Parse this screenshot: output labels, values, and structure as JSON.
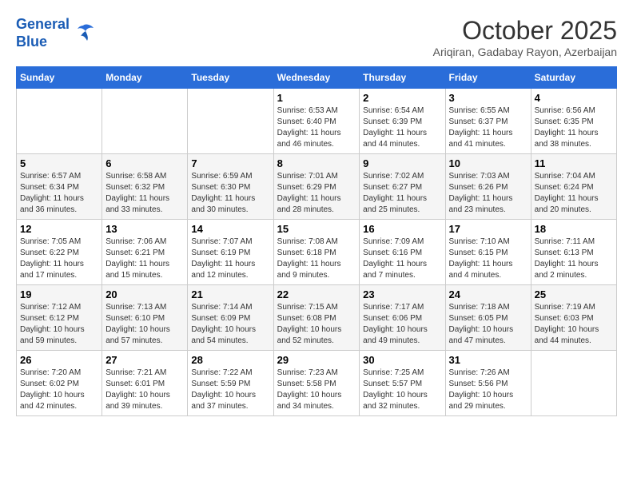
{
  "header": {
    "logo_line1": "General",
    "logo_line2": "Blue",
    "month": "October 2025",
    "location": "Ariqiran, Gadabay Rayon, Azerbaijan"
  },
  "weekdays": [
    "Sunday",
    "Monday",
    "Tuesday",
    "Wednesday",
    "Thursday",
    "Friday",
    "Saturday"
  ],
  "weeks": [
    [
      {
        "day": "",
        "sunrise": "",
        "sunset": "",
        "daylight": ""
      },
      {
        "day": "",
        "sunrise": "",
        "sunset": "",
        "daylight": ""
      },
      {
        "day": "",
        "sunrise": "",
        "sunset": "",
        "daylight": ""
      },
      {
        "day": "1",
        "sunrise": "Sunrise: 6:53 AM",
        "sunset": "Sunset: 6:40 PM",
        "daylight": "Daylight: 11 hours and 46 minutes."
      },
      {
        "day": "2",
        "sunrise": "Sunrise: 6:54 AM",
        "sunset": "Sunset: 6:39 PM",
        "daylight": "Daylight: 11 hours and 44 minutes."
      },
      {
        "day": "3",
        "sunrise": "Sunrise: 6:55 AM",
        "sunset": "Sunset: 6:37 PM",
        "daylight": "Daylight: 11 hours and 41 minutes."
      },
      {
        "day": "4",
        "sunrise": "Sunrise: 6:56 AM",
        "sunset": "Sunset: 6:35 PM",
        "daylight": "Daylight: 11 hours and 38 minutes."
      }
    ],
    [
      {
        "day": "5",
        "sunrise": "Sunrise: 6:57 AM",
        "sunset": "Sunset: 6:34 PM",
        "daylight": "Daylight: 11 hours and 36 minutes."
      },
      {
        "day": "6",
        "sunrise": "Sunrise: 6:58 AM",
        "sunset": "Sunset: 6:32 PM",
        "daylight": "Daylight: 11 hours and 33 minutes."
      },
      {
        "day": "7",
        "sunrise": "Sunrise: 6:59 AM",
        "sunset": "Sunset: 6:30 PM",
        "daylight": "Daylight: 11 hours and 30 minutes."
      },
      {
        "day": "8",
        "sunrise": "Sunrise: 7:01 AM",
        "sunset": "Sunset: 6:29 PM",
        "daylight": "Daylight: 11 hours and 28 minutes."
      },
      {
        "day": "9",
        "sunrise": "Sunrise: 7:02 AM",
        "sunset": "Sunset: 6:27 PM",
        "daylight": "Daylight: 11 hours and 25 minutes."
      },
      {
        "day": "10",
        "sunrise": "Sunrise: 7:03 AM",
        "sunset": "Sunset: 6:26 PM",
        "daylight": "Daylight: 11 hours and 23 minutes."
      },
      {
        "day": "11",
        "sunrise": "Sunrise: 7:04 AM",
        "sunset": "Sunset: 6:24 PM",
        "daylight": "Daylight: 11 hours and 20 minutes."
      }
    ],
    [
      {
        "day": "12",
        "sunrise": "Sunrise: 7:05 AM",
        "sunset": "Sunset: 6:22 PM",
        "daylight": "Daylight: 11 hours and 17 minutes."
      },
      {
        "day": "13",
        "sunrise": "Sunrise: 7:06 AM",
        "sunset": "Sunset: 6:21 PM",
        "daylight": "Daylight: 11 hours and 15 minutes."
      },
      {
        "day": "14",
        "sunrise": "Sunrise: 7:07 AM",
        "sunset": "Sunset: 6:19 PM",
        "daylight": "Daylight: 11 hours and 12 minutes."
      },
      {
        "day": "15",
        "sunrise": "Sunrise: 7:08 AM",
        "sunset": "Sunset: 6:18 PM",
        "daylight": "Daylight: 11 hours and 9 minutes."
      },
      {
        "day": "16",
        "sunrise": "Sunrise: 7:09 AM",
        "sunset": "Sunset: 6:16 PM",
        "daylight": "Daylight: 11 hours and 7 minutes."
      },
      {
        "day": "17",
        "sunrise": "Sunrise: 7:10 AM",
        "sunset": "Sunset: 6:15 PM",
        "daylight": "Daylight: 11 hours and 4 minutes."
      },
      {
        "day": "18",
        "sunrise": "Sunrise: 7:11 AM",
        "sunset": "Sunset: 6:13 PM",
        "daylight": "Daylight: 11 hours and 2 minutes."
      }
    ],
    [
      {
        "day": "19",
        "sunrise": "Sunrise: 7:12 AM",
        "sunset": "Sunset: 6:12 PM",
        "daylight": "Daylight: 10 hours and 59 minutes."
      },
      {
        "day": "20",
        "sunrise": "Sunrise: 7:13 AM",
        "sunset": "Sunset: 6:10 PM",
        "daylight": "Daylight: 10 hours and 57 minutes."
      },
      {
        "day": "21",
        "sunrise": "Sunrise: 7:14 AM",
        "sunset": "Sunset: 6:09 PM",
        "daylight": "Daylight: 10 hours and 54 minutes."
      },
      {
        "day": "22",
        "sunrise": "Sunrise: 7:15 AM",
        "sunset": "Sunset: 6:08 PM",
        "daylight": "Daylight: 10 hours and 52 minutes."
      },
      {
        "day": "23",
        "sunrise": "Sunrise: 7:17 AM",
        "sunset": "Sunset: 6:06 PM",
        "daylight": "Daylight: 10 hours and 49 minutes."
      },
      {
        "day": "24",
        "sunrise": "Sunrise: 7:18 AM",
        "sunset": "Sunset: 6:05 PM",
        "daylight": "Daylight: 10 hours and 47 minutes."
      },
      {
        "day": "25",
        "sunrise": "Sunrise: 7:19 AM",
        "sunset": "Sunset: 6:03 PM",
        "daylight": "Daylight: 10 hours and 44 minutes."
      }
    ],
    [
      {
        "day": "26",
        "sunrise": "Sunrise: 7:20 AM",
        "sunset": "Sunset: 6:02 PM",
        "daylight": "Daylight: 10 hours and 42 minutes."
      },
      {
        "day": "27",
        "sunrise": "Sunrise: 7:21 AM",
        "sunset": "Sunset: 6:01 PM",
        "daylight": "Daylight: 10 hours and 39 minutes."
      },
      {
        "day": "28",
        "sunrise": "Sunrise: 7:22 AM",
        "sunset": "Sunset: 5:59 PM",
        "daylight": "Daylight: 10 hours and 37 minutes."
      },
      {
        "day": "29",
        "sunrise": "Sunrise: 7:23 AM",
        "sunset": "Sunset: 5:58 PM",
        "daylight": "Daylight: 10 hours and 34 minutes."
      },
      {
        "day": "30",
        "sunrise": "Sunrise: 7:25 AM",
        "sunset": "Sunset: 5:57 PM",
        "daylight": "Daylight: 10 hours and 32 minutes."
      },
      {
        "day": "31",
        "sunrise": "Sunrise: 7:26 AM",
        "sunset": "Sunset: 5:56 PM",
        "daylight": "Daylight: 10 hours and 29 minutes."
      },
      {
        "day": "",
        "sunrise": "",
        "sunset": "",
        "daylight": ""
      }
    ]
  ]
}
